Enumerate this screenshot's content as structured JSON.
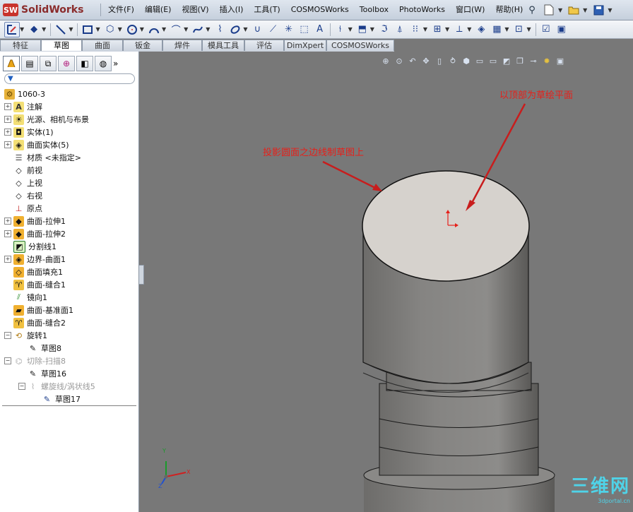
{
  "app": {
    "brand": "SolidWorks",
    "logo_mark": "SW"
  },
  "menu": [
    "文件(F)",
    "编辑(E)",
    "视图(V)",
    "插入(I)",
    "工具(T)",
    "COSMOSWorks",
    "Toolbox",
    "PhotoWorks",
    "窗口(W)",
    "帮助(H)"
  ],
  "tabs": [
    {
      "label": "特征",
      "active": false
    },
    {
      "label": "草图",
      "active": true
    },
    {
      "label": "曲面",
      "active": false
    },
    {
      "label": "钣金",
      "active": false
    },
    {
      "label": "焊件",
      "active": false
    },
    {
      "label": "模具工具",
      "active": false
    },
    {
      "label": "评估",
      "active": false
    },
    {
      "label": "DimXpert",
      "active": false
    },
    {
      "label": "COSMOSWorks",
      "active": false
    }
  ],
  "tree": {
    "root": "1060-3",
    "items": [
      {
        "label": "注解",
        "icon": "annotation-icon"
      },
      {
        "label": "光源、相机与布景",
        "icon": "lights-icon"
      },
      {
        "label": "实体(1)",
        "icon": "solid-bodies-icon"
      },
      {
        "label": "曲面实体(5)",
        "icon": "surface-bodies-icon"
      },
      {
        "label": "材质 <未指定>",
        "icon": "material-icon"
      },
      {
        "label": "前视",
        "icon": "plane-icon"
      },
      {
        "label": "上视",
        "icon": "plane-icon"
      },
      {
        "label": "右视",
        "icon": "plane-icon"
      },
      {
        "label": "原点",
        "icon": "origin-icon"
      },
      {
        "label": "曲面-拉伸1",
        "icon": "surface-extrude-icon"
      },
      {
        "label": "曲面-拉伸2",
        "icon": "surface-extrude-icon"
      },
      {
        "label": "分割线1",
        "icon": "split-line-icon"
      },
      {
        "label": "边界-曲面1",
        "icon": "boundary-surface-icon"
      },
      {
        "label": "曲面填充1",
        "icon": "surface-fill-icon"
      },
      {
        "label": "曲面-缝合1",
        "icon": "surface-knit-icon"
      },
      {
        "label": "镜向1",
        "icon": "mirror-icon"
      },
      {
        "label": "曲面-基准面1",
        "icon": "planar-surface-icon"
      },
      {
        "label": "曲面-缝合2",
        "icon": "surface-knit-icon"
      },
      {
        "label": "旋转1",
        "icon": "revolve-icon"
      },
      {
        "label": "草图8",
        "icon": "sketch-icon"
      },
      {
        "label": "切除-扫描8",
        "icon": "cut-sweep-icon"
      },
      {
        "label": "草图16",
        "icon": "sketch-icon"
      },
      {
        "label": "螺旋线/涡状线5",
        "icon": "helix-icon"
      },
      {
        "label": "草图17",
        "icon": "sketch-icon"
      }
    ]
  },
  "annotations": {
    "top_plane": "以顶部为草绘平面",
    "project_edge": "投影圆面之边线制草图上"
  },
  "triad": {
    "x": "X",
    "y": "Y",
    "z": "Z"
  },
  "watermark": {
    "main": "三维网",
    "sub": "3dportal.cn"
  },
  "colors": {
    "accent": "#e6201a",
    "viewport_bg": "#787878",
    "top_face": "#d6d2cd"
  }
}
